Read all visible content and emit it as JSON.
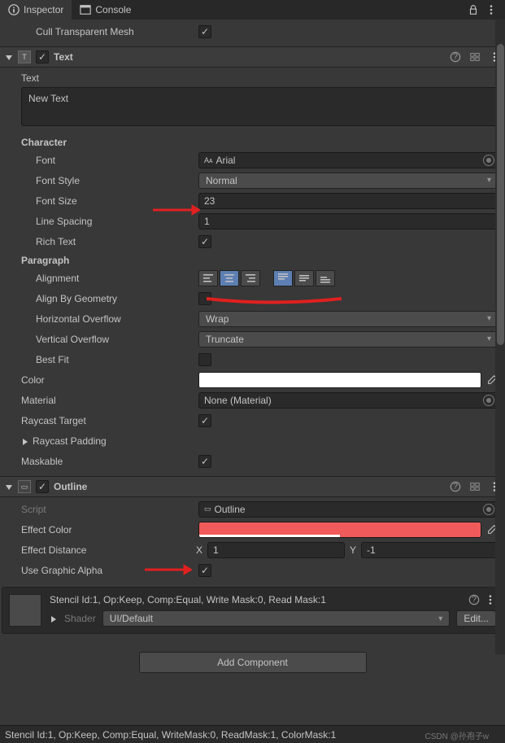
{
  "tabs": {
    "inspector": "Inspector",
    "console": "Console"
  },
  "cullTransparent": {
    "label": "Cull Transparent Mesh"
  },
  "textComp": {
    "title": "Text",
    "textLabel": "Text",
    "textValue": "New Text",
    "character": "Character",
    "font": {
      "label": "Font",
      "value": "Arial"
    },
    "fontStyle": {
      "label": "Font Style",
      "value": "Normal"
    },
    "fontSize": {
      "label": "Font Size",
      "value": "23"
    },
    "lineSpacing": {
      "label": "Line Spacing",
      "value": "1"
    },
    "richText": {
      "label": "Rich Text"
    },
    "paragraph": "Paragraph",
    "alignment": {
      "label": "Alignment"
    },
    "alignByGeom": {
      "label": "Align By Geometry"
    },
    "hOverflow": {
      "label": "Horizontal Overflow",
      "value": "Wrap"
    },
    "vOverflow": {
      "label": "Vertical Overflow",
      "value": "Truncate"
    },
    "bestFit": {
      "label": "Best Fit"
    },
    "color": {
      "label": "Color"
    },
    "material": {
      "label": "Material",
      "value": "None (Material)"
    },
    "raycastTarget": {
      "label": "Raycast Target"
    },
    "raycastPadding": {
      "label": "Raycast Padding"
    },
    "maskable": {
      "label": "Maskable"
    }
  },
  "outlineComp": {
    "title": "Outline",
    "script": {
      "label": "Script",
      "value": "Outline"
    },
    "effectColor": {
      "label": "Effect Color",
      "hex": "#f05a5a",
      "alpha": 50
    },
    "effectDistance": {
      "label": "Effect Distance",
      "x": "1",
      "y": "-1"
    },
    "useGraphicAlpha": {
      "label": "Use Graphic Alpha"
    }
  },
  "shader": {
    "line1": "Stencil Id:1, Op:Keep, Comp:Equal, Write Mask:0, Read Mask:1",
    "label": "Shader",
    "value": "UI/Default",
    "edit": "Edit..."
  },
  "addComponent": "Add Component",
  "footer": "Stencil Id:1, Op:Keep, Comp:Equal, WriteMask:0, ReadMask:1, ColorMask:1",
  "credit": "CSDN @孙孢子w"
}
